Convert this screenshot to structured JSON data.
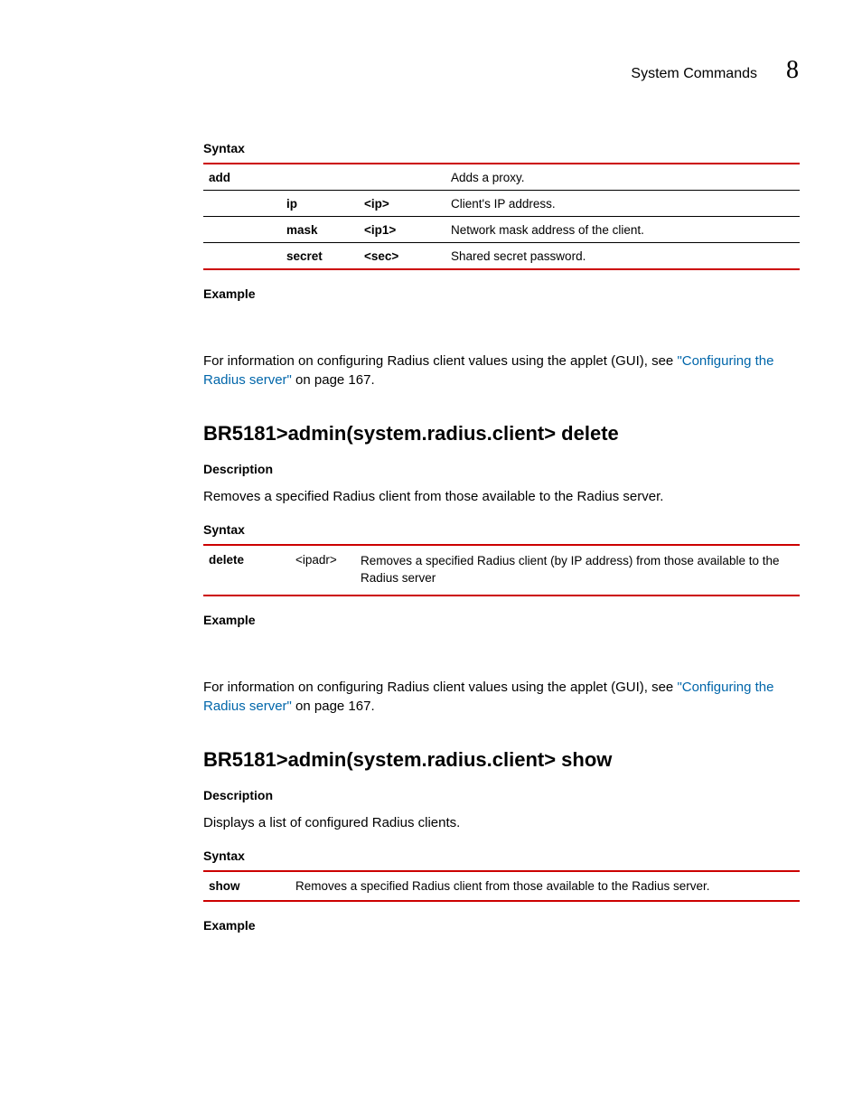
{
  "header": {
    "title": "System Commands",
    "chapter": "8"
  },
  "section1": {
    "syntax_label": "Syntax",
    "example_label": "Example",
    "rows": [
      {
        "cmd": "add",
        "sub": "",
        "arg": "",
        "desc": "Adds a proxy."
      },
      {
        "cmd": "",
        "sub": "ip",
        "arg": "<ip>",
        "desc": "Client's IP address."
      },
      {
        "cmd": "",
        "sub": "mask",
        "arg": "<ip1>",
        "desc": "Network mask address of the client."
      },
      {
        "cmd": "",
        "sub": "secret",
        "arg": "<sec>",
        "desc": "Shared secret password."
      }
    ],
    "info_pre": "For information on configuring Radius client values using the applet (GUI), see ",
    "info_link": "\"Configuring the Radius server\"",
    "info_post": " on page 167."
  },
  "section2": {
    "heading": "BR5181>admin(system.radius.client> delete",
    "description_label": "Description",
    "description_text": "Removes a specified Radius client from those available to the Radius server.",
    "syntax_label": "Syntax",
    "row": {
      "cmd": "delete",
      "arg": "<ipadr>",
      "desc": "Removes a specified Radius client (by IP address) from those available to the Radius server"
    },
    "example_label": "Example",
    "info_pre": "For information on configuring Radius client values using the applet (GUI), see ",
    "info_link": "\"Configuring the Radius server\"",
    "info_post": " on page 167."
  },
  "section3": {
    "heading": "BR5181>admin(system.radius.client> show",
    "description_label": "Description",
    "description_text": "Displays a list of configured Radius clients.",
    "syntax_label": "Syntax",
    "row": {
      "cmd": "show",
      "desc": "Removes a specified Radius client from those available to the Radius server."
    },
    "example_label": "Example"
  }
}
